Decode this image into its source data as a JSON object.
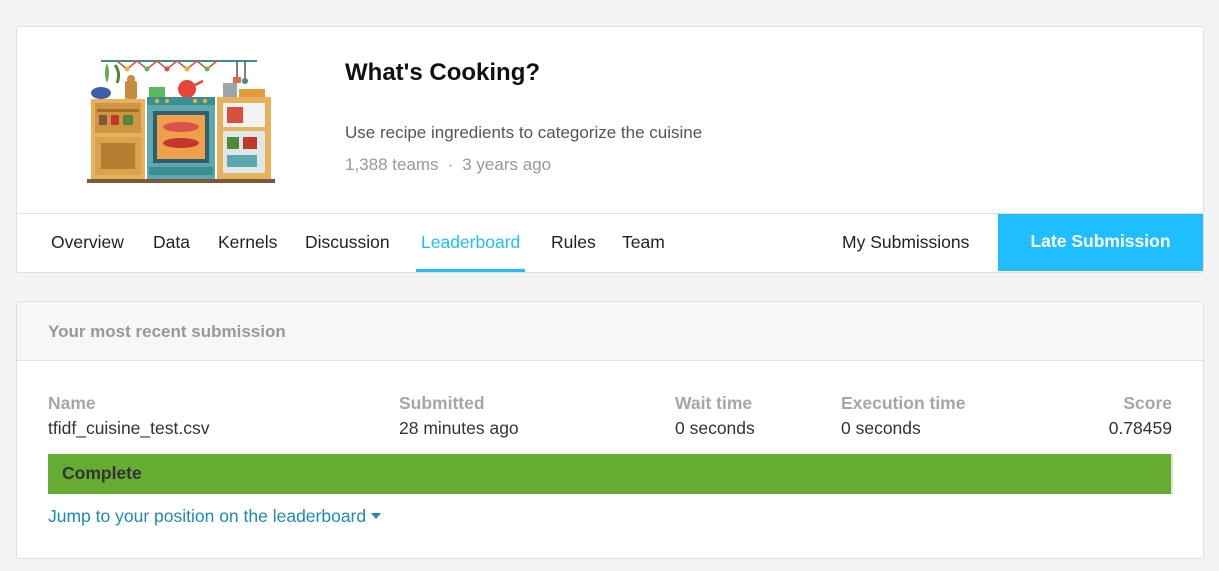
{
  "competition": {
    "title": "What's Cooking?",
    "subtitle": "Use recipe ingredients to categorize the cuisine",
    "teams": "1,388 teams",
    "separator": "·",
    "age": "3 years ago",
    "image_icon": "kitchen-illustration-icon"
  },
  "tabs": {
    "overview": "Overview",
    "data": "Data",
    "kernels": "Kernels",
    "discussion": "Discussion",
    "leaderboard": "Leaderboard",
    "rules": "Rules",
    "team": "Team",
    "active": "Leaderboard"
  },
  "actions": {
    "my_submissions": "My Submissions",
    "late_submission": "Late Submission"
  },
  "submission": {
    "header": "Your most recent submission",
    "columns": {
      "name": "Name",
      "submitted": "Submitted",
      "wait_time": "Wait time",
      "execution_time": "Execution time",
      "score": "Score"
    },
    "values": {
      "name": "tfidf_cuisine_test.csv",
      "submitted": "28 minutes ago",
      "wait_time": "0 seconds",
      "execution_time": "0 seconds",
      "score": "0.78459"
    },
    "status": "Complete",
    "jump_link": "Jump to your position on the leaderboard",
    "jump_icon": "caret-down-icon"
  },
  "colors": {
    "accent": "#20beff",
    "status_complete": "#66ac33",
    "link": "#1f89b5"
  }
}
